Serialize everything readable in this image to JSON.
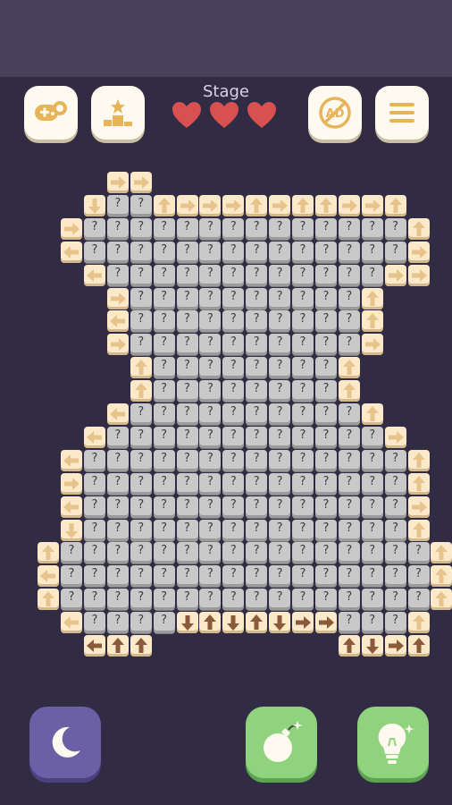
{
  "header": {
    "stage_label": "Stage",
    "lives": 3,
    "buttons": [
      {
        "name": "game-controller-button",
        "icon": "gamepad-icon"
      },
      {
        "name": "leaderboard-button",
        "icon": "podium-icon"
      },
      {
        "name": "no-ads-button",
        "icon": "no-ads-icon"
      },
      {
        "name": "menu-button",
        "icon": "hamburger-menu-icon"
      }
    ]
  },
  "board": {
    "unknown_symbol": "?",
    "arrow_rows": [
      {
        "r": 0,
        "items": [
          [
            4,
            "r"
          ],
          [
            5,
            "r"
          ]
        ]
      },
      {
        "r": 1,
        "items": [
          [
            3,
            "d"
          ],
          [
            6,
            "u"
          ],
          [
            7,
            "r"
          ],
          [
            8,
            "r"
          ],
          [
            9,
            "r"
          ],
          [
            10,
            "u"
          ],
          [
            11,
            "r"
          ],
          [
            12,
            "u"
          ],
          [
            13,
            "u"
          ],
          [
            14,
            "r"
          ],
          [
            15,
            "r"
          ],
          [
            16,
            "u"
          ]
        ]
      },
      {
        "r": 2,
        "items": [
          [
            2,
            "r"
          ],
          [
            17,
            "u"
          ]
        ]
      },
      {
        "r": 3,
        "items": [
          [
            2,
            "l"
          ],
          [
            17,
            "r"
          ]
        ]
      },
      {
        "r": 4,
        "items": [
          [
            3,
            "l"
          ],
          [
            16,
            "r"
          ],
          [
            17,
            "r"
          ]
        ]
      },
      {
        "r": 5,
        "items": [
          [
            4,
            "r"
          ],
          [
            15,
            "u"
          ]
        ]
      },
      {
        "r": 6,
        "items": [
          [
            4,
            "l"
          ],
          [
            15,
            "u"
          ]
        ]
      },
      {
        "r": 7,
        "items": [
          [
            4,
            "r"
          ],
          [
            15,
            "r"
          ]
        ]
      },
      {
        "r": 8,
        "items": [
          [
            5,
            "u"
          ],
          [
            14,
            "u"
          ]
        ]
      },
      {
        "r": 9,
        "items": [
          [
            5,
            "u"
          ],
          [
            14,
            "u"
          ]
        ]
      },
      {
        "r": 10,
        "items": [
          [
            4,
            "l"
          ],
          [
            15,
            "u"
          ]
        ]
      },
      {
        "r": 11,
        "items": [
          [
            3,
            "l"
          ],
          [
            16,
            "r"
          ]
        ]
      },
      {
        "r": 12,
        "items": [
          [
            2,
            "l"
          ],
          [
            17,
            "u"
          ]
        ]
      },
      {
        "r": 13,
        "items": [
          [
            2,
            "r"
          ],
          [
            17,
            "u"
          ]
        ]
      },
      {
        "r": 14,
        "items": [
          [
            2,
            "l"
          ],
          [
            17,
            "r"
          ]
        ]
      },
      {
        "r": 15,
        "items": [
          [
            2,
            "d"
          ],
          [
            17,
            "u"
          ]
        ]
      },
      {
        "r": 16,
        "items": [
          [
            1,
            "u"
          ],
          [
            18,
            "u"
          ]
        ]
      },
      {
        "r": 17,
        "items": [
          [
            1,
            "l"
          ],
          [
            18,
            "u"
          ]
        ]
      },
      {
        "r": 18,
        "items": [
          [
            1,
            "u"
          ],
          [
            18,
            "u"
          ]
        ]
      },
      {
        "r": 19,
        "items": [
          [
            2,
            "l"
          ],
          [
            7,
            "d"
          ],
          [
            8,
            "u"
          ],
          [
            9,
            "d"
          ],
          [
            10,
            "u"
          ],
          [
            11,
            "d"
          ],
          [
            12,
            "r"
          ],
          [
            13,
            "r"
          ],
          [
            17,
            "u"
          ]
        ]
      },
      {
        "r": 20,
        "items": [
          [
            3,
            "l"
          ],
          [
            4,
            "u"
          ],
          [
            5,
            "u"
          ],
          [
            14,
            "u"
          ],
          [
            15,
            "d"
          ],
          [
            16,
            "r"
          ],
          [
            17,
            "u"
          ]
        ]
      }
    ],
    "gray_rows": [
      {
        "r": 1,
        "from": 4,
        "to": 5
      },
      {
        "r": 2,
        "from": 3,
        "to": 16
      },
      {
        "r": 3,
        "from": 3,
        "to": 16
      },
      {
        "r": 4,
        "from": 4,
        "to": 15
      },
      {
        "r": 5,
        "from": 5,
        "to": 14
      },
      {
        "r": 6,
        "from": 5,
        "to": 14
      },
      {
        "r": 7,
        "from": 5,
        "to": 14
      },
      {
        "r": 8,
        "from": 6,
        "to": 13
      },
      {
        "r": 9,
        "from": 6,
        "to": 13
      },
      {
        "r": 10,
        "from": 5,
        "to": 14
      },
      {
        "r": 11,
        "from": 4,
        "to": 15
      },
      {
        "r": 12,
        "from": 3,
        "to": 16
      },
      {
        "r": 13,
        "from": 3,
        "to": 16
      },
      {
        "r": 14,
        "from": 3,
        "to": 16
      },
      {
        "r": 15,
        "from": 3,
        "to": 16
      },
      {
        "r": 16,
        "from": 2,
        "to": 17
      },
      {
        "r": 17,
        "from": 2,
        "to": 17
      },
      {
        "r": 18,
        "from": 2,
        "to": 17
      },
      {
        "r": 19,
        "from": 3,
        "to": 6
      },
      {
        "r": 19,
        "from": 14,
        "to": 16
      }
    ]
  },
  "bottom": [
    {
      "name": "night-mode-button",
      "icon": "moon-icon"
    },
    {
      "name": "bomb-button",
      "icon": "bomb-icon"
    },
    {
      "name": "hint-button",
      "icon": "lightbulb-icon"
    }
  ],
  "colors": {
    "background": "#312c43",
    "topbar": "#47415e",
    "tile_gray": "#c9c9c9",
    "tile_cream": "#fbe9c9",
    "arrow_light": "#e8c48d",
    "arrow_dark": "#8a5a3a",
    "heart": "#d95050",
    "green_button": "#8fd37e",
    "purple_button": "#6b5fa5"
  }
}
